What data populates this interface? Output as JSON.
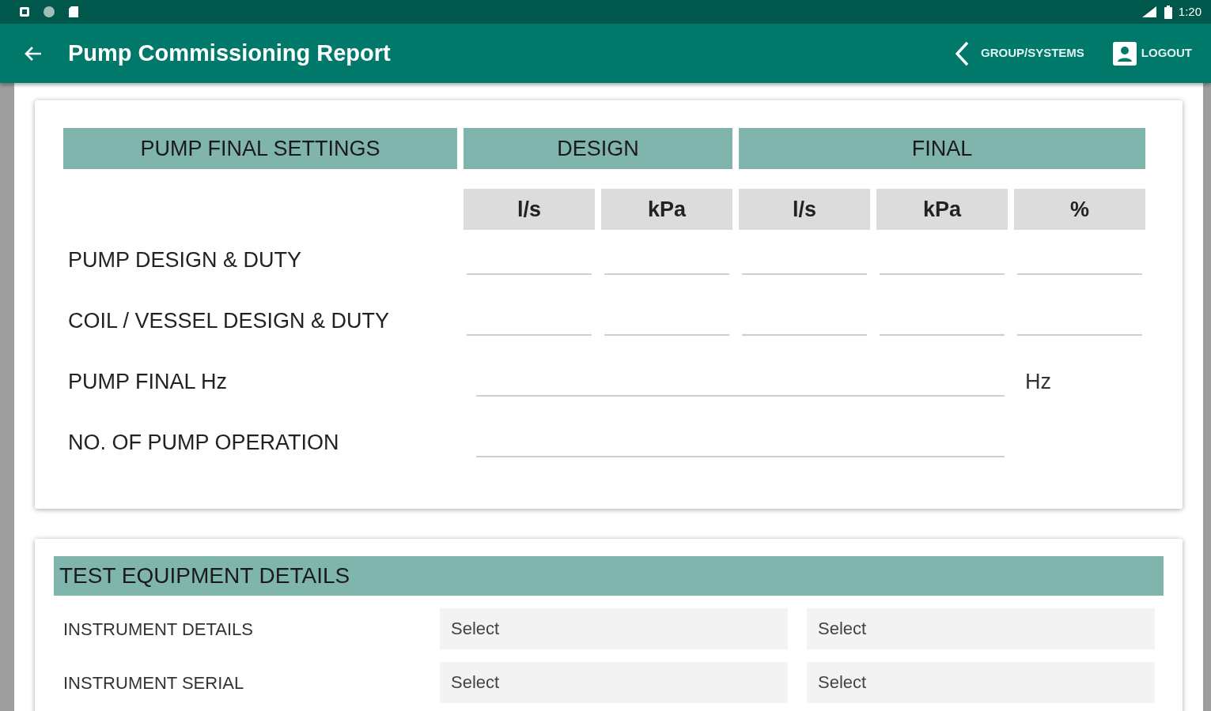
{
  "status_bar": {
    "time": "1:20"
  },
  "app_bar": {
    "title": "Pump Commissioning Report",
    "nav_link": "GROUP/SYSTEMS",
    "logout": "LOGOUT"
  },
  "settings_card": {
    "headers": [
      {
        "label": "PUMP FINAL SETTINGS",
        "kind": "single"
      },
      {
        "label": "DESIGN",
        "kind": "pair"
      },
      {
        "label": "FINAL",
        "kind": "triple"
      }
    ],
    "units": [
      "l/s",
      "kPa",
      "l/s",
      "kPa",
      "%"
    ],
    "rows": [
      {
        "label": "PUMP DESIGN & DUTY",
        "kind": "five_fields"
      },
      {
        "label": "COIL / VESSEL DESIGN & DUTY",
        "kind": "five_fields"
      },
      {
        "label": "PUMP FINAL Hz",
        "kind": "wide_field",
        "unit": "Hz"
      },
      {
        "label": "NO. OF PUMP OPERATION",
        "kind": "wide_field"
      }
    ]
  },
  "equipment_card": {
    "title": "TEST EQUIPMENT DETAILS",
    "rows": [
      {
        "label": "INSTRUMENT DETAILS",
        "fields": [
          {
            "placeholder": "Select"
          },
          {
            "placeholder": "Select"
          }
        ]
      },
      {
        "label": "INSTRUMENT SERIAL",
        "fields": [
          {
            "placeholder": "Select"
          },
          {
            "placeholder": "Select"
          }
        ]
      }
    ]
  }
}
